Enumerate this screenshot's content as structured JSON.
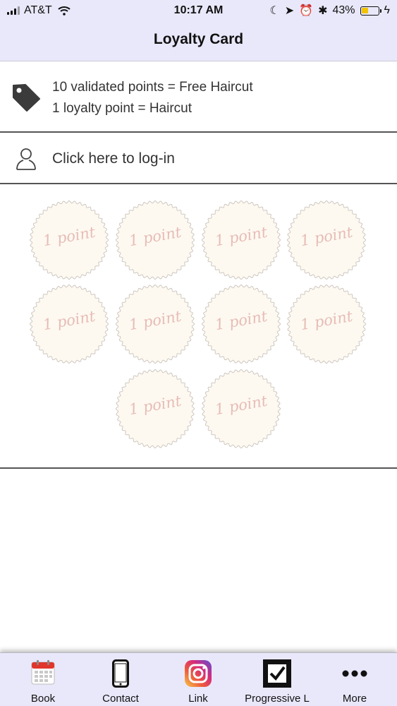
{
  "status_bar": {
    "carrier": "AT&T",
    "time": "10:17 AM",
    "battery": "43%",
    "battery_level": 0.43
  },
  "nav": {
    "title": "Loyalty Card"
  },
  "info": {
    "icon": "tag-icon",
    "lines": [
      "10 validated points = Free Haircut",
      "1 loyalty point = Haircut"
    ]
  },
  "login": {
    "icon": "user-icon",
    "label": "Click here to log-in"
  },
  "stamps": {
    "total": 10,
    "validated": 0,
    "label": "1 point",
    "items": [
      {
        "label": "1 point"
      },
      {
        "label": "1 point"
      },
      {
        "label": "1 point"
      },
      {
        "label": "1 point"
      },
      {
        "label": "1 point"
      },
      {
        "label": "1 point"
      },
      {
        "label": "1 point"
      },
      {
        "label": "1 point"
      },
      {
        "label": "1 point"
      },
      {
        "label": "1 point"
      }
    ]
  },
  "tabs": [
    {
      "label": "Book",
      "icon": "calendar-icon"
    },
    {
      "label": "Contact",
      "icon": "phone-icon"
    },
    {
      "label": "Link",
      "icon": "instagram-icon"
    },
    {
      "label": "Progressive L",
      "icon": "checkbox-icon"
    },
    {
      "label": "More",
      "icon": "more-icon"
    }
  ]
}
